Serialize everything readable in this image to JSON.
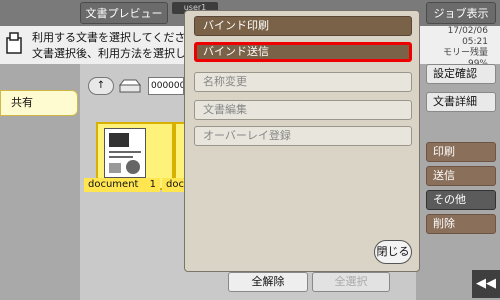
{
  "topbar": {
    "preview_button": "文書プレビュー",
    "user_tab": "user1",
    "job_button": "ジョブ表示"
  },
  "info": {
    "line1": "利用する文書を選択してくださ",
    "line2": "文書選択後、利用方法を選択し",
    "date": "17/02/06",
    "time": "05:21",
    "memory_label": "モリー残量",
    "memory_value": "99%"
  },
  "left": {
    "shared_tab": "共有"
  },
  "folder": {
    "path": "000000"
  },
  "documents": [
    {
      "name": "document",
      "count": "1"
    },
    {
      "name": "docu"
    }
  ],
  "bottom": {
    "clear_all": "全解除",
    "select_all": "全選択"
  },
  "sidebar": {
    "settings_confirm": "設定確認",
    "doc_detail": "文書詳細",
    "print": "印刷",
    "send": "送信",
    "other": "その他",
    "delete": "削除"
  },
  "popup": {
    "items": [
      {
        "label": "バインド印刷",
        "state": "active"
      },
      {
        "label": "バインド送信",
        "state": "selected"
      },
      {
        "label": "名称変更",
        "state": "disabled"
      },
      {
        "label": "文書編集",
        "state": "disabled"
      },
      {
        "label": "オーバーレイ登録",
        "state": "disabled"
      }
    ],
    "close": "閉じる"
  },
  "colors": {
    "accent_brown": "#7a6248",
    "highlight_red": "#e00000",
    "doc_yellow": "#fff27a"
  }
}
